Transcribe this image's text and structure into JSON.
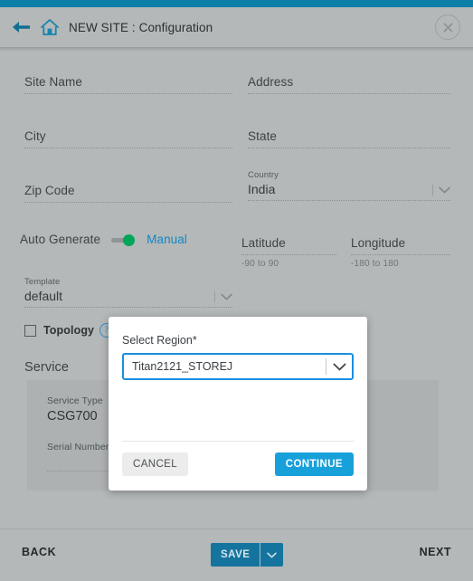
{
  "theme": {
    "accent_blue": "#0c7ea8",
    "page_bg": "#b4b8b8",
    "link_blue": "#1288c4",
    "toggle_green": "#00a65a",
    "modal_focus_blue": "#1a8fe0",
    "continue_blue": "#18a0da",
    "save_blue": "#15749e"
  },
  "header": {
    "back_icon": "arrow-left-icon",
    "home_icon": "home-icon",
    "title": "NEW SITE : Configuration",
    "close_icon": "close-icon"
  },
  "form": {
    "site_name": {
      "label": "Site Name",
      "value": ""
    },
    "address": {
      "label": "Address",
      "value": ""
    },
    "city": {
      "label": "City",
      "value": ""
    },
    "state": {
      "label": "State",
      "value": ""
    },
    "zip_code": {
      "label": "Zip Code",
      "value": ""
    },
    "country": {
      "label": "Country",
      "value": "India",
      "caret_icon": "chevron-down-icon"
    },
    "auto_generate": {
      "label": "Auto Generate",
      "mode": "Manual",
      "toggle_state": "on"
    },
    "latitude": {
      "label": "Latitude",
      "value": "",
      "hint": "-90 to 90"
    },
    "longitude": {
      "label": "Longitude",
      "value": "",
      "hint": "-180 to 180"
    },
    "template": {
      "label": "Template",
      "value": "default",
      "caret_icon": "chevron-down-icon"
    },
    "topology": {
      "label": "Topology",
      "checked": false,
      "help_icon": "help-icon",
      "help_glyph": "?"
    }
  },
  "service": {
    "title": "Service",
    "service_type": {
      "label": "Service Type",
      "value": "CSG700"
    },
    "serial_number": {
      "label": "Serial Number",
      "value": ""
    }
  },
  "footer": {
    "back": "BACK",
    "save": "SAVE",
    "save_caret_icon": "chevron-down-icon",
    "next": "NEXT"
  },
  "modal": {
    "label": "Select Region*",
    "select_value": "Titan2121_STOREJ",
    "select_caret_icon": "chevron-down-icon",
    "cancel": "CANCEL",
    "continue": "CONTINUE"
  }
}
